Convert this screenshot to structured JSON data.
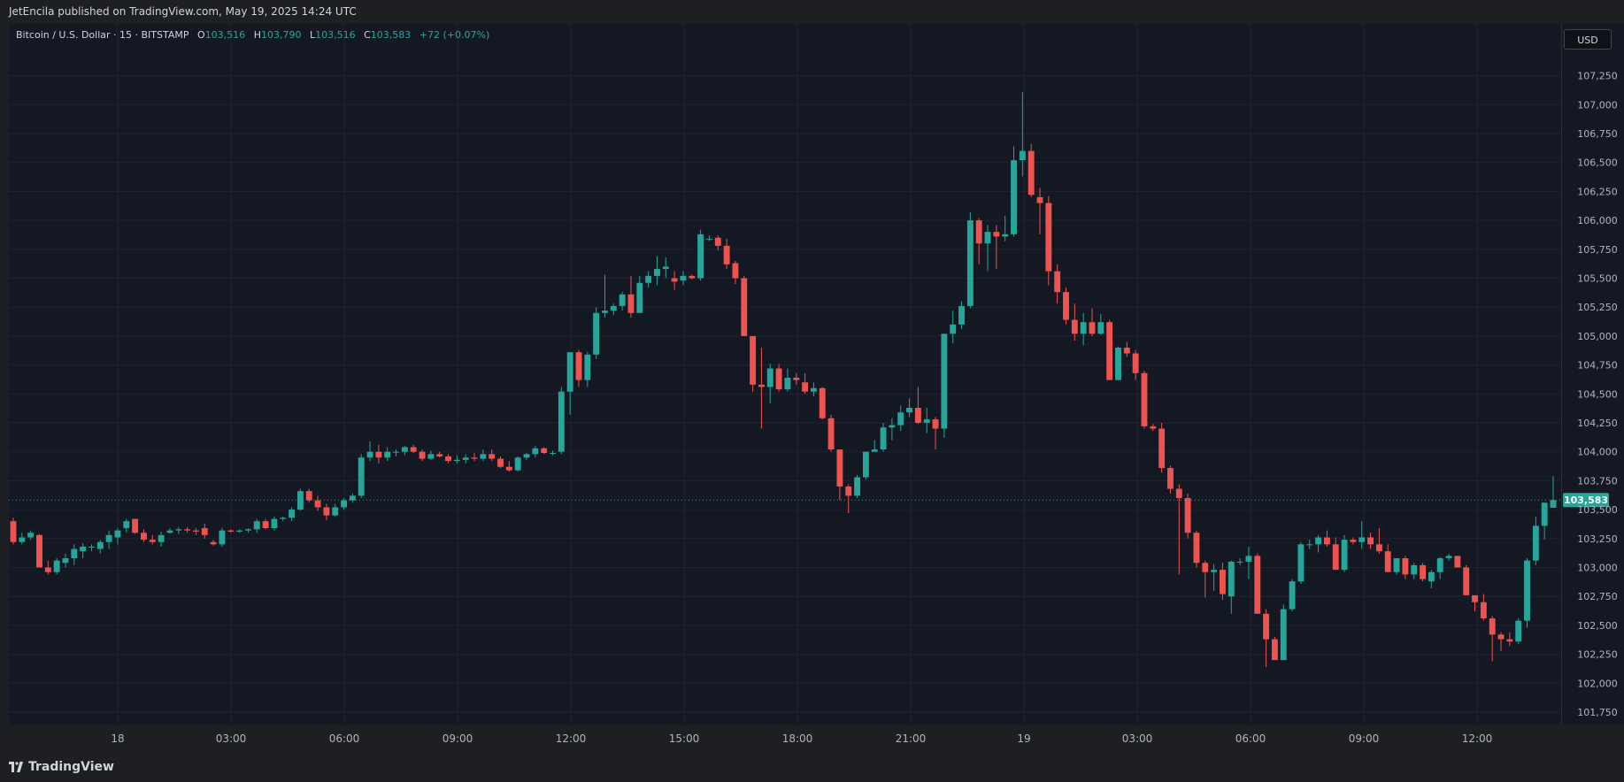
{
  "header": {
    "published_text": "JetEncila published on TradingView.com, May 19, 2025 14:24 UTC"
  },
  "legend": {
    "symbol_text": "Bitcoin / U.S. Dollar · 15 · BITSTAMP",
    "open_label": "O",
    "open_value": "103,516",
    "high_label": "H",
    "high_value": "103,790",
    "low_label": "L",
    "low_value": "103,516",
    "close_label": "C",
    "close_value": "103,583",
    "change_text": "+72 (+0.07%)"
  },
  "currency_button": {
    "label": "USD"
  },
  "footer": {
    "brand_text": "TradingView"
  },
  "colors": {
    "up": "#26a69a",
    "down": "#ef5350",
    "background": "#141823",
    "grid": "#1f2330",
    "price_line": "#26a69a"
  },
  "chart_data": {
    "type": "candlestick",
    "symbol": "Bitcoin / U.S. Dollar",
    "interval": "15",
    "exchange": "BITSTAMP",
    "currency": "USD",
    "y_ticks": [
      101750,
      102000,
      102250,
      102500,
      102750,
      103000,
      103250,
      103500,
      103750,
      104000,
      104250,
      104500,
      104750,
      105000,
      105250,
      105500,
      105750,
      106000,
      106250,
      106500,
      106750,
      107000,
      107250
    ],
    "y_tick_labels": [
      "101,750",
      "102,000",
      "102,250",
      "102,500",
      "102,750",
      "103,000",
      "103,250",
      "103,500",
      "103,750",
      "104,000",
      "104,250",
      "104,500",
      "104,750",
      "105,000",
      "105,250",
      "105,500",
      "105,750",
      "106,000",
      "106,250",
      "106,500",
      "106,750",
      "107,000",
      "107,250"
    ],
    "x_tick_labels": [
      "18",
      "03:00",
      "06:00",
      "09:00",
      "12:00",
      "15:00",
      "18:00",
      "21:00",
      "19",
      "03:00",
      "06:00",
      "09:00",
      "12:00"
    ],
    "last_price": 103583,
    "last_price_label": "103,583",
    "grid": true,
    "candles": [
      [
        103400,
        103430,
        103200,
        103220
      ],
      [
        103220,
        103300,
        103200,
        103260
      ],
      [
        103260,
        103320,
        103240,
        103300
      ],
      [
        103280,
        103290,
        103000,
        103000
      ],
      [
        103000,
        103060,
        102940,
        102960
      ],
      [
        102960,
        103080,
        102940,
        103060
      ],
      [
        103040,
        103120,
        103000,
        103080
      ],
      [
        103080,
        103200,
        103020,
        103160
      ],
      [
        103140,
        103210,
        103080,
        103180
      ],
      [
        103180,
        103200,
        103140,
        103180
      ],
      [
        103160,
        103240,
        103120,
        103220
      ],
      [
        103220,
        103320,
        103160,
        103280
      ],
      [
        103260,
        103340,
        103200,
        103320
      ],
      [
        103340,
        103420,
        103300,
        103400
      ],
      [
        103420,
        103420,
        103290,
        103300
      ],
      [
        103300,
        103330,
        103220,
        103240
      ],
      [
        103240,
        103280,
        103200,
        103220
      ],
      [
        103220,
        103310,
        103180,
        103280
      ],
      [
        103300,
        103340,
        103290,
        103320
      ],
      [
        103320,
        103350,
        103290,
        103330
      ],
      [
        103330,
        103350,
        103300,
        103320
      ],
      [
        103320,
        103340,
        103280,
        103310
      ],
      [
        103340,
        103380,
        103250,
        103280
      ],
      [
        103220,
        103240,
        103190,
        103200
      ],
      [
        103200,
        103340,
        103180,
        103320
      ],
      [
        103320,
        103330,
        103300,
        103310
      ],
      [
        103310,
        103330,
        103300,
        103320
      ],
      [
        103320,
        103340,
        103300,
        103330
      ],
      [
        103330,
        103420,
        103300,
        103400
      ],
      [
        103400,
        103420,
        103330,
        103340
      ],
      [
        103340,
        103440,
        103320,
        103420
      ],
      [
        103420,
        103440,
        103400,
        103430
      ],
      [
        103430,
        103520,
        103400,
        103500
      ],
      [
        103500,
        103680,
        103490,
        103660
      ],
      [
        103660,
        103680,
        103560,
        103580
      ],
      [
        103580,
        103620,
        103490,
        103520
      ],
      [
        103520,
        103550,
        103410,
        103450
      ],
      [
        103450,
        103550,
        103440,
        103520
      ],
      [
        103520,
        103600,
        103500,
        103580
      ],
      [
        103580,
        103640,
        103560,
        103620
      ],
      [
        103620,
        103980,
        103600,
        103950
      ],
      [
        103950,
        104090,
        103920,
        104000
      ],
      [
        104000,
        104060,
        103900,
        103950
      ],
      [
        103950,
        104040,
        103920,
        104000
      ],
      [
        104000,
        104020,
        103960,
        104000
      ],
      [
        104000,
        104050,
        103970,
        104040
      ],
      [
        104040,
        104060,
        103990,
        104000
      ],
      [
        104000,
        104020,
        103920,
        103940
      ],
      [
        103940,
        104010,
        103930,
        103980
      ],
      [
        103980,
        104000,
        103950,
        103960
      ],
      [
        103960,
        103980,
        103900,
        103920
      ],
      [
        103920,
        103970,
        103900,
        103930
      ],
      [
        103930,
        103980,
        103900,
        103950
      ],
      [
        103950,
        103990,
        103920,
        103940
      ],
      [
        103940,
        104020,
        103920,
        103980
      ],
      [
        103980,
        104020,
        103920,
        103940
      ],
      [
        103940,
        103960,
        103860,
        103870
      ],
      [
        103870,
        103920,
        103830,
        103840
      ],
      [
        103840,
        103960,
        103830,
        103950
      ],
      [
        103950,
        103990,
        103930,
        103980
      ],
      [
        103980,
        104050,
        103950,
        104030
      ],
      [
        104030,
        104040,
        103980,
        103990
      ],
      [
        103990,
        104010,
        103970,
        103990
      ],
      [
        104000,
        104560,
        103980,
        104520
      ],
      [
        104520,
        104860,
        104320,
        104860
      ],
      [
        104860,
        104880,
        104560,
        104620
      ],
      [
        104620,
        104860,
        104560,
        104840
      ],
      [
        104840,
        105250,
        104800,
        105200
      ],
      [
        105200,
        105530,
        105160,
        105220
      ],
      [
        105220,
        105280,
        105180,
        105260
      ],
      [
        105260,
        105380,
        105220,
        105360
      ],
      [
        105360,
        105520,
        105160,
        105200
      ],
      [
        105200,
        105520,
        105200,
        105460
      ],
      [
        105460,
        105560,
        105420,
        105520
      ],
      [
        105520,
        105690,
        105440,
        105580
      ],
      [
        105580,
        105680,
        105500,
        105600
      ],
      [
        105500,
        105560,
        105400,
        105470
      ],
      [
        105480,
        105560,
        105440,
        105520
      ],
      [
        105520,
        105530,
        105490,
        105500
      ],
      [
        105500,
        105920,
        105480,
        105880
      ],
      [
        105840,
        105870,
        105820,
        105840
      ],
      [
        105850,
        105870,
        105740,
        105780
      ],
      [
        105780,
        105840,
        105580,
        105620
      ],
      [
        105630,
        105650,
        105450,
        105500
      ],
      [
        105500,
        105520,
        105000,
        105000
      ],
      [
        105000,
        105000,
        104520,
        104580
      ],
      [
        104580,
        104900,
        104200,
        104560
      ],
      [
        104560,
        104760,
        104420,
        104720
      ],
      [
        104720,
        104760,
        104520,
        104540
      ],
      [
        104540,
        104720,
        104520,
        104640
      ],
      [
        104640,
        104680,
        104580,
        104620
      ],
      [
        104600,
        104680,
        104500,
        104520
      ],
      [
        104520,
        104600,
        104480,
        104550
      ],
      [
        104550,
        104560,
        104280,
        104290
      ],
      [
        104290,
        104320,
        104000,
        104020
      ],
      [
        104020,
        104020,
        103580,
        103700
      ],
      [
        103700,
        103720,
        103470,
        103620
      ],
      [
        103620,
        103800,
        103600,
        103780
      ],
      [
        103780,
        104000,
        103760,
        104000
      ],
      [
        104000,
        104100,
        104000,
        104020
      ],
      [
        104020,
        104250,
        104000,
        104210
      ],
      [
        104210,
        104290,
        104100,
        104230
      ],
      [
        104230,
        104400,
        104180,
        104340
      ],
      [
        104340,
        104460,
        104300,
        104380
      ],
      [
        104380,
        104560,
        104240,
        104250
      ],
      [
        104250,
        104380,
        104160,
        104280
      ],
      [
        104280,
        104300,
        104020,
        104200
      ],
      [
        104200,
        104960,
        104120,
        105020
      ],
      [
        105020,
        105220,
        104940,
        105100
      ],
      [
        105100,
        105300,
        105060,
        105260
      ],
      [
        105260,
        106070,
        105240,
        106000
      ],
      [
        106000,
        106020,
        105620,
        105800
      ],
      [
        105800,
        105960,
        105560,
        105900
      ],
      [
        105900,
        105960,
        105580,
        105860
      ],
      [
        105860,
        106040,
        105820,
        105880
      ],
      [
        105880,
        106640,
        105860,
        106520
      ],
      [
        106520,
        107110,
        106380,
        106600
      ],
      [
        106600,
        106660,
        106200,
        106220
      ],
      [
        106200,
        106280,
        105880,
        106150
      ],
      [
        106150,
        106210,
        105440,
        105560
      ],
      [
        105560,
        105620,
        105280,
        105380
      ],
      [
        105380,
        105420,
        105100,
        105140
      ],
      [
        105140,
        105280,
        104960,
        105020
      ],
      [
        105020,
        105200,
        104920,
        105120
      ],
      [
        105120,
        105240,
        105000,
        105020
      ],
      [
        105020,
        105190,
        105010,
        105120
      ],
      [
        105120,
        105140,
        104620,
        104620
      ],
      [
        104620,
        104910,
        104620,
        104900
      ],
      [
        104900,
        104950,
        104820,
        104850
      ],
      [
        104850,
        104880,
        104620,
        104680
      ],
      [
        104680,
        104700,
        104200,
        104220
      ],
      [
        104220,
        104240,
        104180,
        104200
      ],
      [
        104200,
        104250,
        103820,
        103860
      ],
      [
        103860,
        103880,
        103640,
        103680
      ],
      [
        103680,
        103720,
        102940,
        103600
      ],
      [
        103600,
        103640,
        103250,
        103300
      ],
      [
        103300,
        103320,
        103000,
        103040
      ],
      [
        103040,
        103060,
        102740,
        102960
      ],
      [
        102960,
        103030,
        102800,
        102980
      ],
      [
        102980,
        103040,
        102720,
        102770
      ],
      [
        102750,
        103060,
        102600,
        103050
      ],
      [
        103050,
        103080,
        103020,
        103050
      ],
      [
        103050,
        103180,
        102900,
        103100
      ],
      [
        103100,
        103120,
        102680,
        102600
      ],
      [
        102600,
        102640,
        102140,
        102380
      ],
      [
        102380,
        102400,
        102200,
        102200
      ],
      [
        102200,
        102680,
        102200,
        102640
      ],
      [
        102640,
        102900,
        102620,
        102880
      ],
      [
        102880,
        103220,
        102860,
        103200
      ],
      [
        103200,
        103240,
        103160,
        103200
      ],
      [
        103200,
        103280,
        103130,
        103260
      ],
      [
        103260,
        103320,
        103180,
        103200
      ],
      [
        103200,
        103260,
        102980,
        102980
      ],
      [
        102980,
        103280,
        102960,
        103240
      ],
      [
        103240,
        103260,
        103200,
        103220
      ],
      [
        103220,
        103400,
        103160,
        103260
      ],
      [
        103260,
        103300,
        103160,
        103200
      ],
      [
        103200,
        103340,
        103120,
        103140
      ],
      [
        103140,
        103200,
        102960,
        102960
      ],
      [
        102960,
        103080,
        102940,
        103080
      ],
      [
        103080,
        103100,
        102900,
        102940
      ],
      [
        102940,
        103040,
        102900,
        103020
      ],
      [
        103020,
        103040,
        102880,
        102900
      ],
      [
        102880,
        102980,
        102820,
        102960
      ],
      [
        102960,
        103090,
        102900,
        103080
      ],
      [
        103080,
        103120,
        103060,
        103100
      ],
      [
        103100,
        103100,
        103000,
        103000
      ],
      [
        103000,
        103020,
        102760,
        102760
      ],
      [
        102760,
        102760,
        102620,
        102700
      ],
      [
        102700,
        102770,
        102540,
        102560
      ],
      [
        102560,
        102580,
        102190,
        102420
      ],
      [
        102420,
        102440,
        102280,
        102380
      ],
      [
        102380,
        102440,
        102320,
        102360
      ],
      [
        102360,
        102560,
        102340,
        102540
      ],
      [
        102540,
        103080,
        102480,
        103060
      ],
      [
        103060,
        103440,
        103020,
        103360
      ],
      [
        103360,
        103560,
        103240,
        103560
      ],
      [
        103516,
        103790,
        103516,
        103583
      ]
    ]
  }
}
